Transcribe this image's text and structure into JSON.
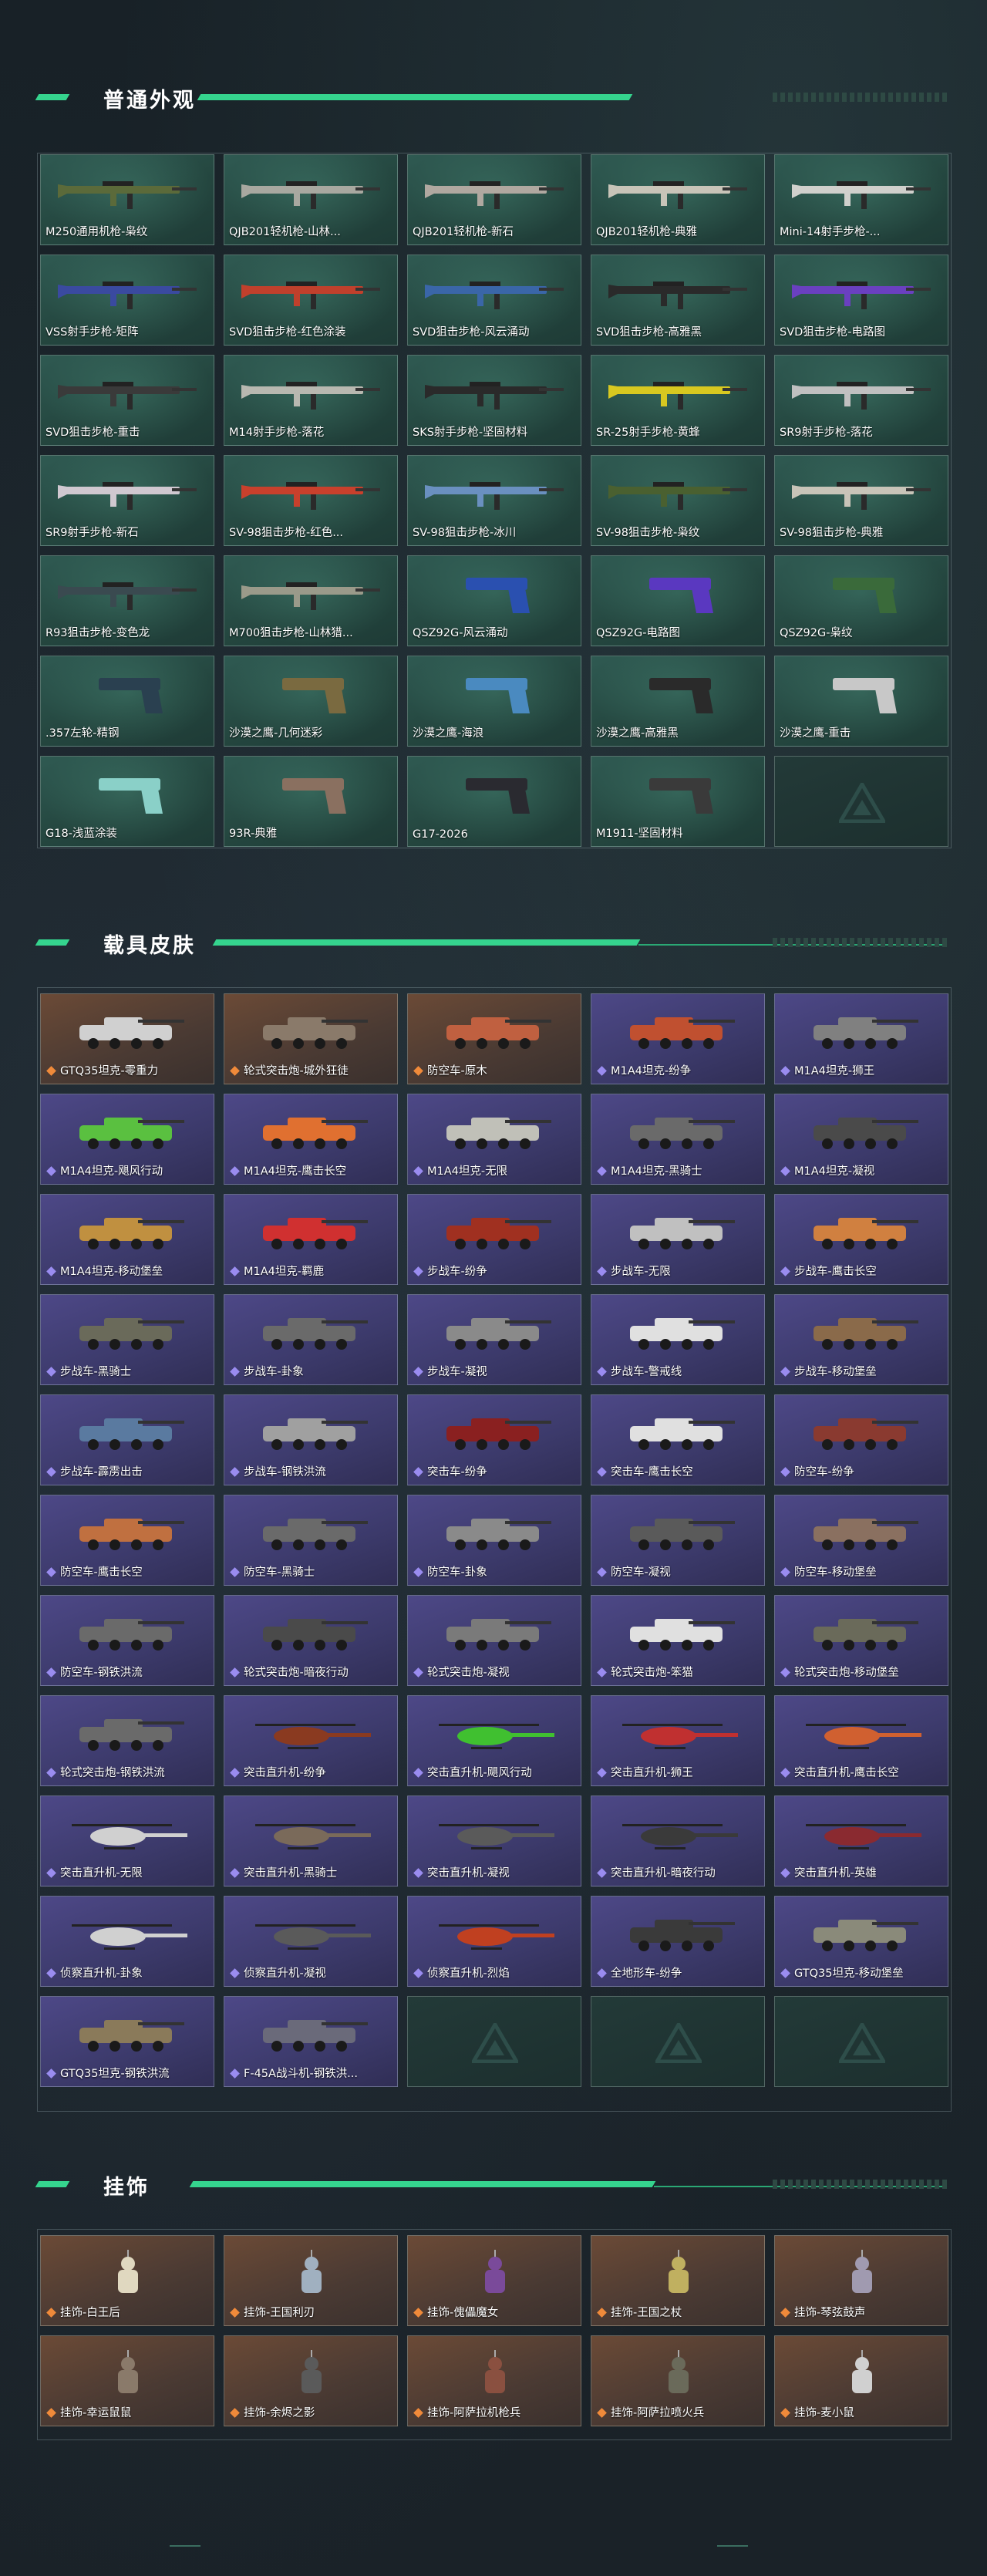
{
  "sections": {
    "weapons": {
      "title": "普通外观",
      "items": [
        "M250通用机枪-枭纹",
        "QJB201轻机枪-山林...",
        "QJB201轻机枪-新石",
        "QJB201轻机枪-典雅",
        "Mini-14射手步枪-...",
        "VSS射手步枪-矩阵",
        "SVD狙击步枪-红色涂装",
        "SVD狙击步枪-风云涌动",
        "SVD狙击步枪-高雅黑",
        "SVD狙击步枪-电路图",
        "SVD狙击步枪-重击",
        "M14射手步枪-落花",
        "SKS射手步枪-坚固材料",
        "SR-25射手步枪-黄蜂",
        "SR9射手步枪-落花",
        "SR9射手步枪-新石",
        "SV-98狙击步枪-红色...",
        "SV-98狙击步枪-冰川",
        "SV-98狙击步枪-枭纹",
        "SV-98狙击步枪-典雅",
        "R93狙击步枪-变色龙",
        "M700狙击步枪-山林猎...",
        "QSZ92G-风云涌动",
        "QSZ92G-电路图",
        "QSZ92G-枭纹",
        ".357左轮-精钢",
        "沙漠之鹰-几何迷彩",
        "沙漠之鹰-海浪",
        "沙漠之鹰-高雅黑",
        "沙漠之鹰-重击",
        "G18-浅蓝涂装",
        "93R-典雅",
        "G17-2026",
        "M1911-坚固材料",
        ""
      ],
      "colors": [
        "#5b6a3a",
        "#a8a8a0",
        "#b0a8a0",
        "#c8c4b8",
        "#d0d0cc",
        "#3a4aa0",
        "#c0402c",
        "#3a66a8",
        "#2a2a2a",
        "#6a40c0",
        "#3a3a3a",
        "#b8b8b0",
        "#2a2a2a",
        "#d8c820",
        "#c0c0c0",
        "#d0c8d0",
        "#c8402c",
        "#6a90c0",
        "#4a6030",
        "#c8c4b8",
        "#3a4a50",
        "#9a9a8a",
        "#2a50b0",
        "#5a38c0",
        "#3a6a3a",
        "#2a4050",
        "#7a6a40",
        "#4a8ac0",
        "#2a2a2a",
        "#c8c8c8",
        "#8ad0c8",
        "#8a7060",
        "#2a2a30",
        "#3a3a3a",
        ""
      ]
    },
    "vehicles": {
      "title": "载具皮肤",
      "items": [
        "GTQ35坦克-零重力",
        "轮式突击炮-城外狂徒",
        "防空车-原木",
        "M1A4坦克-纷争",
        "M1A4坦克-狮王",
        "M1A4坦克-飓风行动",
        "M1A4坦克-鹰击长空",
        "M1A4坦克-无限",
        "M1A4坦克-黑骑士",
        "M1A4坦克-凝视",
        "M1A4坦克-移动堡垒",
        "M1A4坦克-羁鹿",
        "步战车-纷争",
        "步战车-无限",
        "步战车-鹰击长空",
        "步战车-黑骑士",
        "步战车-卦象",
        "步战车-凝视",
        "步战车-警戒线",
        "步战车-移动堡垒",
        "步战车-霹雳出击",
        "步战车-钢铁洪流",
        "突击车-纷争",
        "突击车-鹰击长空",
        "防空车-纷争",
        "防空车-鹰击长空",
        "防空车-黑骑士",
        "防空车-卦象",
        "防空车-凝视",
        "防空车-移动堡垒",
        "防空车-钢铁洪流",
        "轮式突击炮-暗夜行动",
        "轮式突击炮-凝视",
        "轮式突击炮-笨猫",
        "轮式突击炮-移动堡垒",
        "轮式突击炮-钢铁洪流",
        "突击直升机-纷争",
        "突击直升机-飓风行动",
        "突击直升机-狮王",
        "突击直升机-鹰击长空",
        "突击直升机-无限",
        "突击直升机-黑骑士",
        "突击直升机-凝视",
        "突击直升机-暗夜行动",
        "突击直升机-英雄",
        "侦察直升机-卦象",
        "侦察直升机-凝视",
        "侦察直升机-烈焰",
        "全地形车-纷争",
        "GTQ35坦克-移动堡垒",
        "GTQ35坦克-钢铁洪流",
        "F-45A战斗机-钢铁洪...",
        "",
        "",
        ""
      ],
      "tones": [
        "orange",
        "orange",
        "orange",
        "purple",
        "purple",
        "purple",
        "purple",
        "purple",
        "purple",
        "purple",
        "purple",
        "purple",
        "purple",
        "purple",
        "purple",
        "purple",
        "purple",
        "purple",
        "purple",
        "purple",
        "purple",
        "purple",
        "purple",
        "purple",
        "purple",
        "purple",
        "purple",
        "purple",
        "purple",
        "purple",
        "purple",
        "purple",
        "purple",
        "purple",
        "purple",
        "purple",
        "purple",
        "purple",
        "purple",
        "purple",
        "purple",
        "purple",
        "purple",
        "purple",
        "purple",
        "purple",
        "purple",
        "purple",
        "purple",
        "purple",
        "purple",
        "purple",
        "empty",
        "empty",
        "empty"
      ],
      "colors": [
        "#d0d0d0",
        "#8a7a6a",
        "#c06040",
        "#c05030",
        "#808080",
        "#5ac040",
        "#e07030",
        "#c0c0b8",
        "#6a6a6a",
        "#4a4a4a",
        "#c09040",
        "#d03030",
        "#a03020",
        "#c0c0c0",
        "#d08040",
        "#6a6a5a",
        "#6a6a6a",
        "#8a8a8a",
        "#e0e0e0",
        "#8a6a4a",
        "#5a7aa0",
        "#a0a0a0",
        "#8a2020",
        "#e0e0e0",
        "#8a3a30",
        "#c07040",
        "#6a6a6a",
        "#8a8a8a",
        "#5a5a5a",
        "#8a7060",
        "#6a6a6a",
        "#4a4a4a",
        "#7a7a7a",
        "#e0e0e0",
        "#6a6a5a",
        "#6a6a6a",
        "#8a3a20",
        "#40c030",
        "#c03030",
        "#d06030",
        "#d0d0d0",
        "#7a6a5a",
        "#5a5a5a",
        "#3a3a3a",
        "#8a2a30",
        "#d0d0d0",
        "#5a5a5a",
        "#c04020",
        "#3a3a3a",
        "#8a8a7a",
        "#8a7a5a",
        "#6a6a7a",
        "",
        "",
        ""
      ]
    },
    "charms": {
      "title": "挂饰",
      "items": [
        "挂饰-白王后",
        "挂饰-王国利刃",
        "挂饰-傀儡魔女",
        "挂饰-王国之杖",
        "挂饰-琴弦鼓声",
        "挂饰-幸运鼠鼠",
        "挂饰-余烬之影",
        "挂饰-阿萨拉机枪兵",
        "挂饰-阿萨拉喷火兵",
        "挂饰-麦小鼠"
      ],
      "colors": [
        "#e0d8c0",
        "#a0b0c0",
        "#7a4a9a",
        "#c0b060",
        "#a09ab0",
        "#8a7a6a",
        "#5a5a5a",
        "#8a5040",
        "#6a6a5a",
        "#d0d0d0"
      ]
    }
  }
}
